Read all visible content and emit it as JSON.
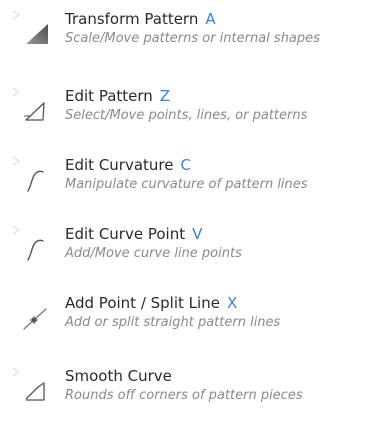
{
  "menu": {
    "items": [
      {
        "label": "Transform Pattern",
        "shortcut": "A",
        "description": "Scale/Move patterns or internal shapes",
        "icon": "transform-pattern-icon"
      },
      {
        "label": "Edit Pattern",
        "shortcut": "Z",
        "description": "Select/Move points, lines, or patterns",
        "icon": "edit-pattern-icon"
      },
      {
        "label": "Edit Curvature",
        "shortcut": "C",
        "description": "Manipulate curvature of pattern lines",
        "icon": "edit-curvature-icon"
      },
      {
        "label": "Edit Curve Point",
        "shortcut": "V",
        "description": "Add/Move curve line points",
        "icon": "edit-curve-point-icon"
      },
      {
        "label": "Add Point / Split Line",
        "shortcut": "X",
        "description": "Add or split straight pattern lines",
        "icon": "add-point-split-line-icon"
      },
      {
        "label": "Smooth Curve",
        "shortcut": "",
        "description": "Rounds off corners of pattern pieces",
        "icon": "smooth-curve-icon"
      }
    ]
  },
  "colors": {
    "title": "#2a2a2a",
    "shortcut": "#3d7fe0",
    "description": "#8a8a8a",
    "icon": "#555555"
  }
}
